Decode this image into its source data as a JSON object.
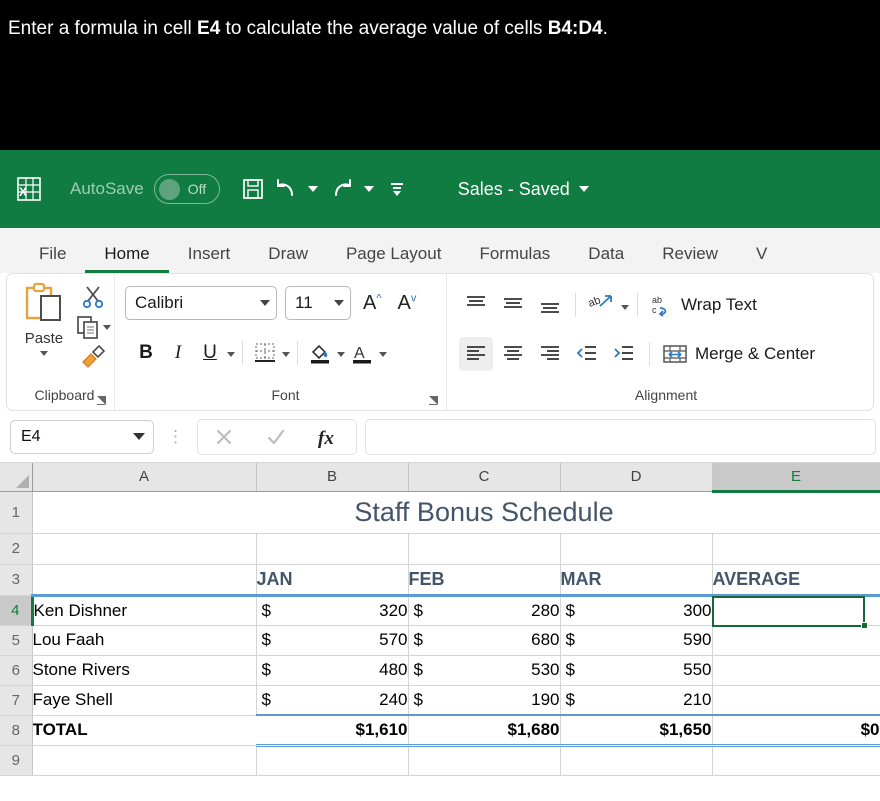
{
  "instruction": {
    "prefix": "Enter a formula in cell ",
    "cell_ref": "E4",
    "middle": " to calculate the average value of cells ",
    "range_ref": "B4:D4",
    "suffix": "."
  },
  "titlebar": {
    "app_icon": "excel-logo-icon",
    "autosave_label": "AutoSave",
    "autosave_state": "Off",
    "save_icon": "save-icon",
    "undo_icon": "undo-icon",
    "redo_icon": "redo-icon",
    "customize_icon": "customize-quick-access-icon",
    "document_title": "Sales - Saved"
  },
  "ribbon_tabs": [
    {
      "label": "File",
      "active": false
    },
    {
      "label": "Home",
      "active": true
    },
    {
      "label": "Insert",
      "active": false
    },
    {
      "label": "Draw",
      "active": false
    },
    {
      "label": "Page Layout",
      "active": false
    },
    {
      "label": "Formulas",
      "active": false
    },
    {
      "label": "Data",
      "active": false
    },
    {
      "label": "Review",
      "active": false
    },
    {
      "label": "V",
      "active": false
    }
  ],
  "ribbon": {
    "clipboard": {
      "group_label": "Clipboard",
      "paste_label": "Paste",
      "cut_icon": "scissors-icon",
      "copy_icon": "copy-icon",
      "format_painter_icon": "format-painter-icon"
    },
    "font": {
      "group_label": "Font",
      "font_name": "Calibri",
      "font_size": "11",
      "grow_font_icon": "increase-font-size-icon",
      "shrink_font_icon": "decrease-font-size-icon",
      "bold_label": "B",
      "italic_label": "I",
      "underline_label": "U",
      "borders_icon": "borders-icon",
      "fill_color_icon": "fill-color-icon",
      "font_color_icon": "font-color-icon"
    },
    "alignment": {
      "group_label": "Alignment",
      "align_top_icon": "align-top-icon",
      "align_middle_icon": "align-middle-icon",
      "align_bottom_icon": "align-bottom-icon",
      "orientation_icon": "orientation-icon",
      "wrap_text_label": "Wrap Text",
      "wrap_text_icon": "wrap-text-icon",
      "align_left_icon": "align-left-icon",
      "align_center_icon": "align-center-icon",
      "align_right_icon": "align-right-icon",
      "decrease_indent_icon": "decrease-indent-icon",
      "increase_indent_icon": "increase-indent-icon",
      "merge_center_label": "Merge & Center",
      "merge_center_icon": "merge-cells-icon"
    }
  },
  "formula_bar": {
    "name_box_value": "E4",
    "cancel_icon": "cancel-icon",
    "enter_icon": "confirm-icon",
    "function_icon": "insert-function-icon",
    "formula_value": ""
  },
  "sheet": {
    "columns": [
      "A",
      "B",
      "C",
      "D",
      "E"
    ],
    "selected_column": "E",
    "rows": [
      "1",
      "2",
      "3",
      "4",
      "5",
      "6",
      "7",
      "8",
      "9"
    ],
    "selected_row": "4",
    "title": "Staff Bonus Schedule",
    "headers": {
      "name": "",
      "jan": "JAN",
      "feb": "FEB",
      "mar": "MAR",
      "average": "AVERAGE"
    },
    "records": [
      {
        "name": "Ken Dishner",
        "jan": "320",
        "feb": "280",
        "mar": "300",
        "average": ""
      },
      {
        "name": "Lou Faah",
        "jan": "570",
        "feb": "680",
        "mar": "590",
        "average": ""
      },
      {
        "name": "Stone Rivers",
        "jan": "480",
        "feb": "530",
        "mar": "550",
        "average": ""
      },
      {
        "name": "Faye Shell",
        "jan": "240",
        "feb": "190",
        "mar": "210",
        "average": ""
      }
    ],
    "currency_symbol": "$",
    "total": {
      "label": "TOTAL",
      "jan": "$1,610",
      "feb": "$1,680",
      "mar": "$1,650",
      "average": "$0"
    },
    "selected_cell": "E4"
  },
  "colors": {
    "excel_green": "#107C41",
    "header_blue": "#44546A",
    "border_blue": "#5B9BD5",
    "selection_green": "#14693a"
  }
}
